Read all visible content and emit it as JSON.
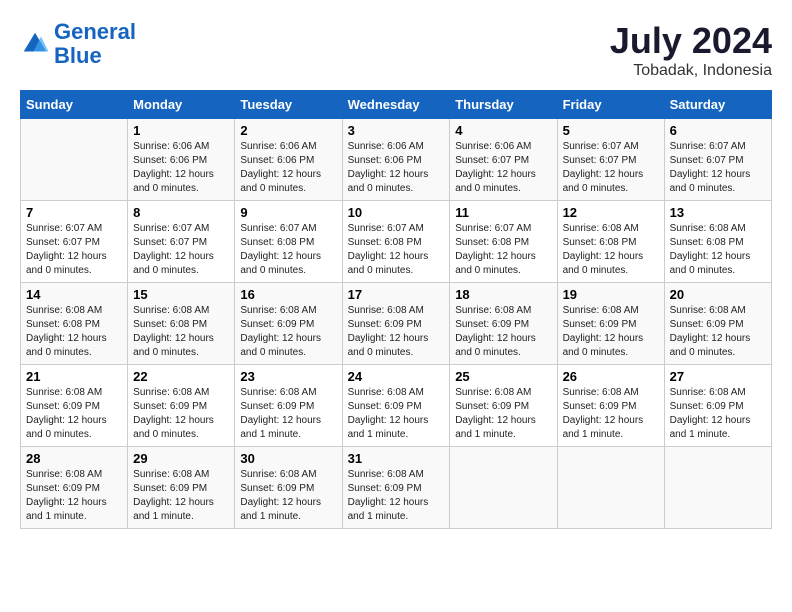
{
  "logo": {
    "line1": "General",
    "line2": "Blue"
  },
  "title": "July 2024",
  "subtitle": "Tobadak, Indonesia",
  "days_of_week": [
    "Sunday",
    "Monday",
    "Tuesday",
    "Wednesday",
    "Thursday",
    "Friday",
    "Saturday"
  ],
  "weeks": [
    [
      {
        "day": "",
        "info": ""
      },
      {
        "day": "1",
        "info": "Sunrise: 6:06 AM\nSunset: 6:06 PM\nDaylight: 12 hours\nand 0 minutes."
      },
      {
        "day": "2",
        "info": "Sunrise: 6:06 AM\nSunset: 6:06 PM\nDaylight: 12 hours\nand 0 minutes."
      },
      {
        "day": "3",
        "info": "Sunrise: 6:06 AM\nSunset: 6:06 PM\nDaylight: 12 hours\nand 0 minutes."
      },
      {
        "day": "4",
        "info": "Sunrise: 6:06 AM\nSunset: 6:07 PM\nDaylight: 12 hours\nand 0 minutes."
      },
      {
        "day": "5",
        "info": "Sunrise: 6:07 AM\nSunset: 6:07 PM\nDaylight: 12 hours\nand 0 minutes."
      },
      {
        "day": "6",
        "info": "Sunrise: 6:07 AM\nSunset: 6:07 PM\nDaylight: 12 hours\nand 0 minutes."
      }
    ],
    [
      {
        "day": "7",
        "info": "Sunrise: 6:07 AM\nSunset: 6:07 PM\nDaylight: 12 hours\nand 0 minutes."
      },
      {
        "day": "8",
        "info": "Sunrise: 6:07 AM\nSunset: 6:07 PM\nDaylight: 12 hours\nand 0 minutes."
      },
      {
        "day": "9",
        "info": "Sunrise: 6:07 AM\nSunset: 6:08 PM\nDaylight: 12 hours\nand 0 minutes."
      },
      {
        "day": "10",
        "info": "Sunrise: 6:07 AM\nSunset: 6:08 PM\nDaylight: 12 hours\nand 0 minutes."
      },
      {
        "day": "11",
        "info": "Sunrise: 6:07 AM\nSunset: 6:08 PM\nDaylight: 12 hours\nand 0 minutes."
      },
      {
        "day": "12",
        "info": "Sunrise: 6:08 AM\nSunset: 6:08 PM\nDaylight: 12 hours\nand 0 minutes."
      },
      {
        "day": "13",
        "info": "Sunrise: 6:08 AM\nSunset: 6:08 PM\nDaylight: 12 hours\nand 0 minutes."
      }
    ],
    [
      {
        "day": "14",
        "info": "Sunrise: 6:08 AM\nSunset: 6:08 PM\nDaylight: 12 hours\nand 0 minutes."
      },
      {
        "day": "15",
        "info": "Sunrise: 6:08 AM\nSunset: 6:08 PM\nDaylight: 12 hours\nand 0 minutes."
      },
      {
        "day": "16",
        "info": "Sunrise: 6:08 AM\nSunset: 6:09 PM\nDaylight: 12 hours\nand 0 minutes."
      },
      {
        "day": "17",
        "info": "Sunrise: 6:08 AM\nSunset: 6:09 PM\nDaylight: 12 hours\nand 0 minutes."
      },
      {
        "day": "18",
        "info": "Sunrise: 6:08 AM\nSunset: 6:09 PM\nDaylight: 12 hours\nand 0 minutes."
      },
      {
        "day": "19",
        "info": "Sunrise: 6:08 AM\nSunset: 6:09 PM\nDaylight: 12 hours\nand 0 minutes."
      },
      {
        "day": "20",
        "info": "Sunrise: 6:08 AM\nSunset: 6:09 PM\nDaylight: 12 hours\nand 0 minutes."
      }
    ],
    [
      {
        "day": "21",
        "info": "Sunrise: 6:08 AM\nSunset: 6:09 PM\nDaylight: 12 hours\nand 0 minutes."
      },
      {
        "day": "22",
        "info": "Sunrise: 6:08 AM\nSunset: 6:09 PM\nDaylight: 12 hours\nand 0 minutes."
      },
      {
        "day": "23",
        "info": "Sunrise: 6:08 AM\nSunset: 6:09 PM\nDaylight: 12 hours\nand 1 minute."
      },
      {
        "day": "24",
        "info": "Sunrise: 6:08 AM\nSunset: 6:09 PM\nDaylight: 12 hours\nand 1 minute."
      },
      {
        "day": "25",
        "info": "Sunrise: 6:08 AM\nSunset: 6:09 PM\nDaylight: 12 hours\nand 1 minute."
      },
      {
        "day": "26",
        "info": "Sunrise: 6:08 AM\nSunset: 6:09 PM\nDaylight: 12 hours\nand 1 minute."
      },
      {
        "day": "27",
        "info": "Sunrise: 6:08 AM\nSunset: 6:09 PM\nDaylight: 12 hours\nand 1 minute."
      }
    ],
    [
      {
        "day": "28",
        "info": "Sunrise: 6:08 AM\nSunset: 6:09 PM\nDaylight: 12 hours\nand 1 minute."
      },
      {
        "day": "29",
        "info": "Sunrise: 6:08 AM\nSunset: 6:09 PM\nDaylight: 12 hours\nand 1 minute."
      },
      {
        "day": "30",
        "info": "Sunrise: 6:08 AM\nSunset: 6:09 PM\nDaylight: 12 hours\nand 1 minute."
      },
      {
        "day": "31",
        "info": "Sunrise: 6:08 AM\nSunset: 6:09 PM\nDaylight: 12 hours\nand 1 minute."
      },
      {
        "day": "",
        "info": ""
      },
      {
        "day": "",
        "info": ""
      },
      {
        "day": "",
        "info": ""
      }
    ]
  ]
}
